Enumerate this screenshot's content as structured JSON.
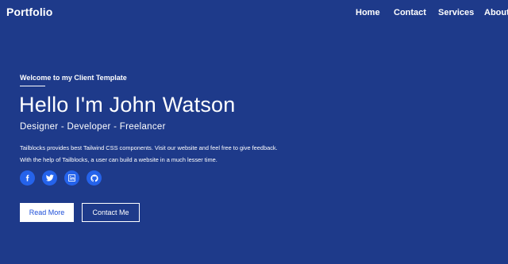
{
  "header": {
    "brand": "Portfolio",
    "nav": [
      {
        "label": "Home"
      },
      {
        "label": "Contact"
      },
      {
        "label": "Services"
      },
      {
        "label": "About"
      }
    ]
  },
  "hero": {
    "welcome": "Welcome to my Client Template",
    "headline": "Hello I'm John Watson",
    "roles": "Designer - Developer - Freelancer",
    "description": "Tailblocks provides best Tailwind CSS components. Visit our website and feel free to give feedback. With the help of Tailblocks, a user can build a website in a much lesser time.",
    "socials": [
      {
        "icon": "facebook-icon"
      },
      {
        "icon": "twitter-icon"
      },
      {
        "icon": "linkedin-icon"
      },
      {
        "icon": "github-icon"
      }
    ],
    "primary_button": "Read More",
    "secondary_button": "Contact Me"
  },
  "colors": {
    "background": "#1e3a8a",
    "social_circle": "#2563eb",
    "primary_button_text": "#1d4ed8",
    "text": "#ffffff"
  }
}
